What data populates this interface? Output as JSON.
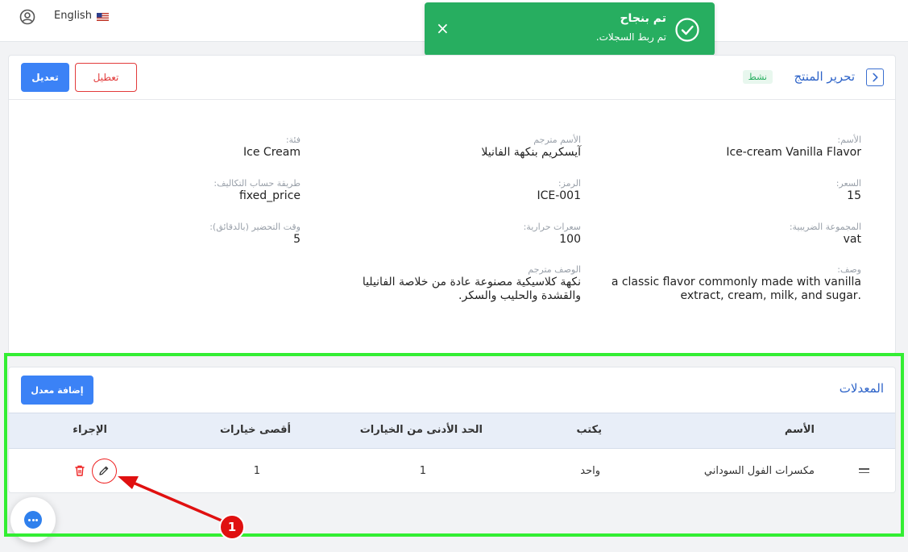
{
  "topbar": {
    "language": "English",
    "user_icon": "user-circle-icon",
    "flag_icon": "us-flag-icon"
  },
  "toast": {
    "title": "تم بنجاح",
    "message": "تم ربط السجلات.",
    "close": "×",
    "icon": "check-circle-icon",
    "color": "#27ae60"
  },
  "product": {
    "title": "تحرير المنتج",
    "status": "نشط",
    "edit_label": "تعديل",
    "disable_label": "تعطيل",
    "fields": {
      "name": {
        "label": "الأسم:",
        "value": "Ice-cream Vanilla Flavor"
      },
      "translated_name": {
        "label": "الأسم مترجم",
        "value": "آيسكريم بنكهة الفانيلا"
      },
      "category": {
        "label": "فئة:",
        "value": "Ice Cream"
      },
      "price": {
        "label": "السعر:",
        "value": "15"
      },
      "sku": {
        "label": "الرمز:",
        "value": "ICE-001"
      },
      "costing_method": {
        "label": "طريقة حساب التكاليف:",
        "value": "fixed_price"
      },
      "tax_group": {
        "label": "المجموعة الضريبية:",
        "value": "vat"
      },
      "calories": {
        "label": "سعرات حرارية:",
        "value": "100"
      },
      "prep_time": {
        "label": "وقت التحضير (بالدقائق):",
        "value": "5"
      },
      "description": {
        "label": "وصف:",
        "line1": "a classic flavor commonly made with vanilla",
        "line2": ".extract, cream, milk, and sugar"
      },
      "translated_description": {
        "label": "الوصف مترجم",
        "line1": "نكهة كلاسيكية مصنوعة عادة من خلاصة الفانيليا",
        "line2": "والقشدة والحليب والسكر."
      }
    }
  },
  "modifiers": {
    "title": "المعدلات",
    "add_label": "إضافة معدل",
    "columns": [
      "الأسم",
      "يكتب",
      "الحد الأدنى من الخيارات",
      "أقصى خيارات",
      "الإجراء"
    ],
    "rows": [
      {
        "name": "مكسرات الفول السوداني",
        "type": "واحد",
        "min": "1",
        "max": "1"
      }
    ]
  },
  "annotation": {
    "step": "1",
    "highlight_color": "#33ee33",
    "arrow_color": "#e01010"
  },
  "chat": {
    "icon": "chat-bubble-icon"
  }
}
